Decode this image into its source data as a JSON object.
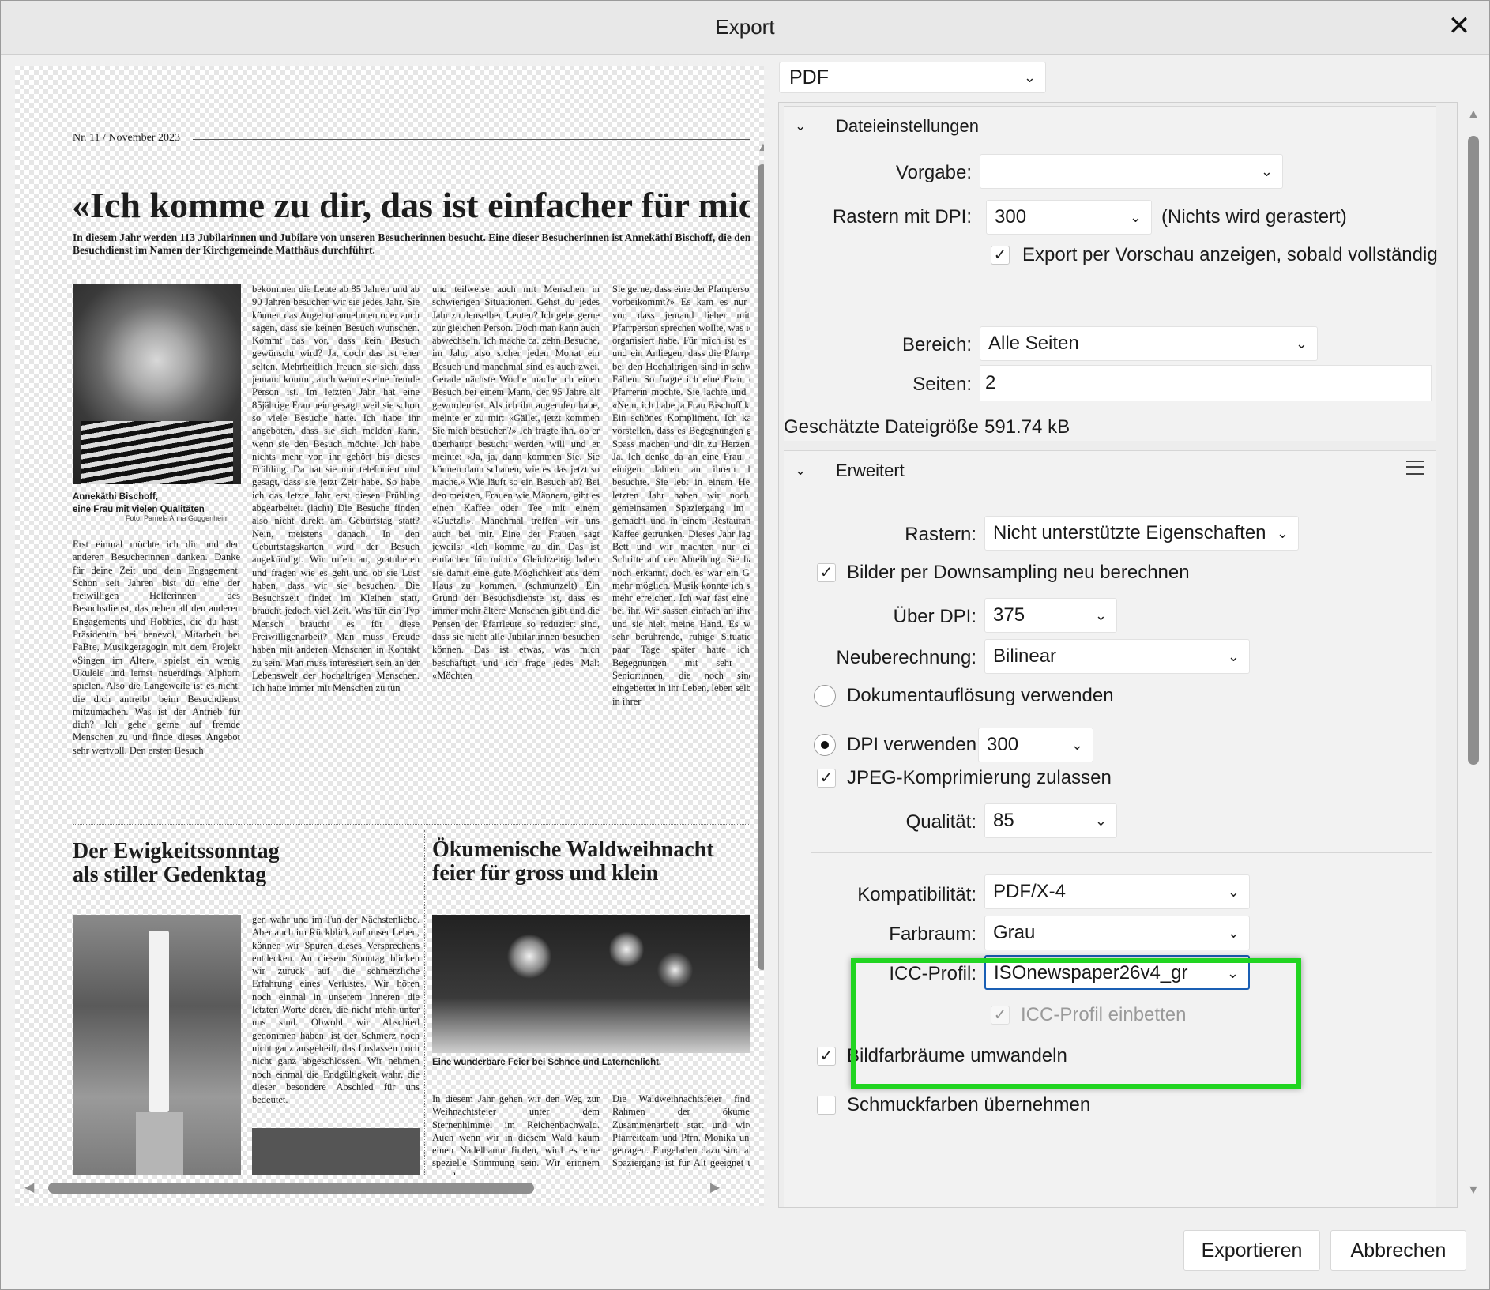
{
  "window": {
    "title": "Export",
    "close_glyph": "✕"
  },
  "preview": {
    "header": "Nr. 11 / November 2023",
    "title": "«Ich komme zu dir, das ist einfacher für mich",
    "lead": "In diesem Jahr werden 113 Jubilarinnen und Jubilare von unseren Besucherinnen besucht. Eine dieser Besucherinnen ist Annekäthi Bischoff, die den Besuchdienst im Namen der Kirchgemeinde Matthäus durchführt.",
    "photo_caption": "Annekäthi Bischoff,\neine Frau mit vielen Qualitäten",
    "photo_credit": "Foto: Pamela Anna Guggenheim",
    "col1": "Erst einmal möchte ich dir und den anderen Besucherinnen danken. Danke für deine Zeit und dein Engagement. Schon seit Jahren bist du eine der freiwilligen Helferinnen des Besuchsdienst, das neben all den anderen Engagements und Hobbies, die du hast: Präsidentin bei benevol, Mitarbeit bei FaBre, Musikgeragogin mit dem Projekt «Singen im Alter», spielst ein wenig Ukulele und lernst neuerdings Alphorn spielen. Also die Langeweile ist es nicht, die dich antreibt beim Besuchdienst mitzumachen. Was ist der Antrieb für dich? Ich gehe gerne auf fremde Menschen zu und finde dieses Angebot sehr wertvoll. Den ersten Besuch",
    "col2": "bekommen die Leute ab 85 Jahren und ab 90 Jahren besuchen wir sie jedes Jahr. Sie können das Angebot annehmen oder auch sagen, dass sie keinen Besuch wünschen. Kommt das vor, dass kein Besuch gewünscht wird? Ja, doch das ist eher selten. Mehrheitlich freuen sie sich, dass jemand kommt, auch wenn es eine fremde Person ist. Im letzten Jahr hat eine 85jährige Frau nein gesagt, weil sie schon so viele Besuche hatte. Ich habe ihr angeboten, dass sie sich melden kann, wenn sie den Besuch möchte. Ich habe nichts mehr von ihr gehört bis dieses Frühling. Da hat sie mir telefoniert und gesagt, dass sie jetzt Zeit habe. So habe ich das letzte Jahr erst diesen Frühling abgearbeitet. (lacht) Die Besuche finden also nicht direkt am Geburtstag statt? Nein, meistens danach. In den Geburtstagskarten wird der Besuch angekündigt. Wir rufen an, gratulieren und fragen wie es geht und ob sie Lust haben, dass wir sie besuchen. Die Besuchszeit findet im Kleinen statt, braucht jedoch viel Zeit. Was für ein Typ Mensch braucht es für diese Freiwilligenarbeit? Man muss Freude haben mit anderen Menschen in Kontakt zu sein. Man muss interessiert sein an der Lebenswelt der hochaltrigen Menschen. Ich hatte immer mit Menschen zu tun",
    "col3": "und teilweise auch mit Menschen in schwierigen Situationen. Gehst du jedes Jahr zu denselben Leuten? Ich gehe gerne zur gleichen Person. Doch man kann auch abwechseln. Ich mache ca. zehn Besuche, im Jahr, also sicher jeden Monat ein Besuch und manchmal sind es auch zwei. Gerade nächste Woche mache ich einen Besuch bei einem Mann, der 95 Jahre alt geworden ist. Als ich ihn angerufen habe, meinte er zu mir: «Gället, jetzt kommen Sie mich besuchen?» Ich fragte ihn, ob er überhaupt besucht werden will und er meinte: «Ja, ja, dann kommen Sie. Sie können dann schauen, wie es das jetzt so mache.» Wie läuft so ein Besuch ab? Bei den meisten, Frauen wie Männern, gibt es einen Kaffee oder Tee mit einem «Guetzli». Manchmal treffen wir uns auch bei mir. Eine der Frauen sagt jeweils: «Ich komme zu dir. Das ist einfacher für mich.» Gleichzeitig haben sie damit eine gute Möglichkeit aus dem Haus zu kommen. (schmunzelt) Ein Grund der Besuchsdienste ist, dass es immer mehr ältere Menschen gibt und die Pensen der Pfarrleute so reduziert sind, dass sie nicht alle Jubilar:innen besuchen können. Das ist etwas, was mich beschäftigt und ich frage jedes Mal: «Möchten",
    "col4": "Sie gerne, dass eine der Pfarrpersonen uns vorbeikommt?» Es kam es nur einmal vor, dass jemand lieber mit einer Pfarrperson sprechen wollte, was ich dann organisiert habe. Für mich ist es wichtig und ein Anliegen, dass die Pfarrpersonen bei den Hochaltrigen sind in schwierigen Fällen. So fragte ich eine Frau, ob eine Pfarrerin möchte. Sie lachte und meinte: «Nein, ich habe ja Frau Bischoff kommt.» Ein schönes Kompliment. Ich kann mir vorstellen, dass es Begegnungen gibt, die Spass machen und dir zu Herzen gehen. Ja. Ich denke da an eine Frau, die seit einigen Jahren an ihrem burtstag besuchte. Sie lebt in einem Heim. Im letzten Jahr haben wir noch einen gemeinsamen Spaziergang im Garten gemacht und in einem Restaurant einen Kaffee getrunken. Dieses Jahr lag sie im Bett und wir machten nur ein paar Schritte auf der Abteilung. Sie hat mich noch erkannt, doch es war ein Gespräch mehr möglich. Musik konnte ich sie nicht mehr erreichen. Ich war fast eine Stunde bei ihr. Wir sassen einfach an ihrem Bett und sie hielt meine Hand. Es war eine sehr berührende, ruhige Situation. Ein paar Tage später hatte ich zwei Begegnungen mit sehr aktiven Senior:innen, die noch sind gut eingebettet in ihr Leben, leben selbständig in ihrer",
    "h2a": "Der Ewigkeitssonntag\nals stiller Gedenktag",
    "h2b": "Ökumenische Waldweihnacht\nfeier für gross und klein",
    "col5": "gen wahr und im Tun der Nächstenliebe. Aber auch im Rückblick auf unser Leben, können wir Spuren dieses Versprechens entdecken. An diesem Sonntag blicken wir zurück auf die schmerzliche Erfahrung eines Verlustes. Wir hören noch einmal in unserem Inneren die letzten Worte derer, die nicht mehr unter uns sind. Obwohl wir Abschied genommen haben, ist der Schmerz noch nicht ganz ausgeheilt, das Loslassen noch nicht ganz abgeschlossen. Wir nehmen noch einmal die Endgültigkeit wahr, die dieser besondere Abschied für uns bedeutet.",
    "photo3_caption": "Eine wunderbare Feier bei Schnee und Laternenlicht.",
    "col6": "In diesem Jahr gehen wir den Weg zur Weihnachtsfeier unter dem Sternenhimmel im Reichenbachwald. Auch wenn wir in diesem Wald kaum einen Nadelbaum finden, wird es eine spezielle Stimmung sein. Wir erinnern uns, dass einst",
    "col7": "Die Waldweihnachtsfeier findet im Rahmen der ökumenischen Zusammenarbeit statt und wird vom Pfarreiteam und Pfrn. Monika und Team getragen. Eingeladen dazu sind alle. Der Spaziergang ist für Alt geeignet und wir machen"
  },
  "format": {
    "value": "PDF"
  },
  "file_settings": {
    "header": "Dateieinstellungen",
    "preset_label": "Vorgabe:",
    "preset_value": "",
    "raster_dpi_label": "Rastern mit DPI:",
    "raster_dpi_value": "300",
    "raster_note": "(Nichts wird gerastert)",
    "preview_checkbox": "Export per Vorschau anzeigen, sobald vollständig",
    "range_label": "Bereich:",
    "range_value": "Alle Seiten",
    "pages_label": "Seiten:",
    "pages_value": "2",
    "filesize_label": "Geschätzte Dateigröße:",
    "filesize_value": "591.74 kB"
  },
  "advanced": {
    "header": "Erweitert",
    "raster_label": "Rastern:",
    "raster_value": "Nicht unterstützte Eigenschaften",
    "downsample_checkbox": "Bilder per Downsampling neu berechnen",
    "above_dpi_label": "Über DPI:",
    "above_dpi_value": "375",
    "resample_label": "Neuberechnung:",
    "resample_value": "Bilinear",
    "doc_res_radio": "Dokumentauflösung verwenden",
    "use_dpi_radio": "DPI verwenden:",
    "use_dpi_value": "300",
    "jpeg_checkbox": "JPEG-Komprimierung zulassen",
    "quality_label": "Qualität:",
    "quality_value": "85",
    "compat_label": "Kompatibilität:",
    "compat_value": "PDF/X-4",
    "colorspace_label": "Farbraum:",
    "colorspace_value": "Grau",
    "icc_label": "ICC-Profil:",
    "icc_value": "ISOnewspaper26v4_gr",
    "embed_icc_checkbox": "ICC-Profil einbetten",
    "convert_checkbox": "Bildfarbräume umwandeln",
    "spot_checkbox": "Schmuckfarben übernehmen"
  },
  "buttons": {
    "export": "Exportieren",
    "cancel": "Abbrechen"
  },
  "colors": {
    "highlight": "#21d521",
    "focus": "#1a5fb4"
  }
}
